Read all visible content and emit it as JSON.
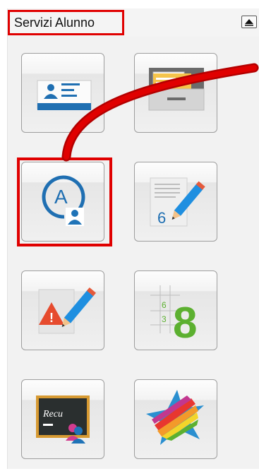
{
  "panel": {
    "title": "Servizi Alunno"
  },
  "tiles": [
    {
      "icon": "student-id-card-icon"
    },
    {
      "icon": "folder-drawer-icon"
    },
    {
      "icon": "student-absences-icon",
      "label": "A"
    },
    {
      "icon": "grades-notebook-icon",
      "label": "6"
    },
    {
      "icon": "disciplinary-notes-icon",
      "label": "!"
    },
    {
      "icon": "grades-grid-icon",
      "label": "8",
      "small_labels": [
        "6",
        "3"
      ]
    },
    {
      "icon": "recovery-blackboard-icon",
      "label": "Recu"
    },
    {
      "icon": "colorful-star-icon"
    }
  ],
  "colors": {
    "highlight": "#e00000",
    "accent_blue": "#1f73b7",
    "grade_green": "#5cb030"
  }
}
